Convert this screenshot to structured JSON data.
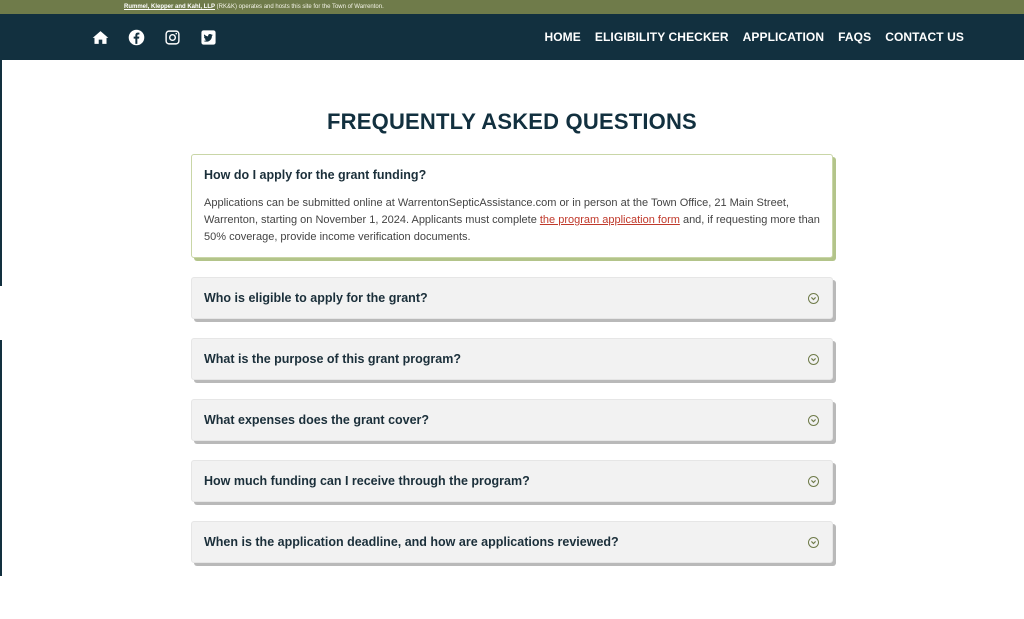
{
  "topbar": {
    "firm_link": "Rummel, Klepper and Kahl, LLP",
    "text": " (RK&K) operates and hosts this site for the Town of Warrenton."
  },
  "social": [
    {
      "icon": "home-icon"
    },
    {
      "icon": "facebook-icon"
    },
    {
      "icon": "instagram-icon"
    },
    {
      "icon": "twitter-icon"
    }
  ],
  "menu": {
    "home": "HOME",
    "eligibility": "ELIGIBILITY CHECKER",
    "application": "APPLICATION",
    "faqs": "FAQS",
    "contact": "CONTACT US"
  },
  "page": {
    "title": "FREQUENTLY ASKED QUESTIONS"
  },
  "faq_open": {
    "question": "How do I apply for the grant funding?",
    "answer_before": "Applications can be submitted online at WarrentonSepticAssistance.com or in person at the Town Office, 21 Main Street, Warrenton, starting on November 1, 2024. Applicants must complete ",
    "answer_link": "the program application form",
    "answer_after": " and, if requesting more than 50% coverage, provide income verification documents."
  },
  "faqs": [
    {
      "question": "Who is eligible to apply for the grant?"
    },
    {
      "question": "What is the purpose of this grant program?"
    },
    {
      "question": "What expenses does the grant cover?"
    },
    {
      "question": "How much funding can I receive through the program?"
    },
    {
      "question": "When is the application deadline, and how are applications reviewed?"
    }
  ],
  "colors": {
    "nav_bg": "#12303f",
    "topbar_bg": "#6f7b4a",
    "accent_green": "#b3c48a",
    "link_red": "#c0392b"
  }
}
